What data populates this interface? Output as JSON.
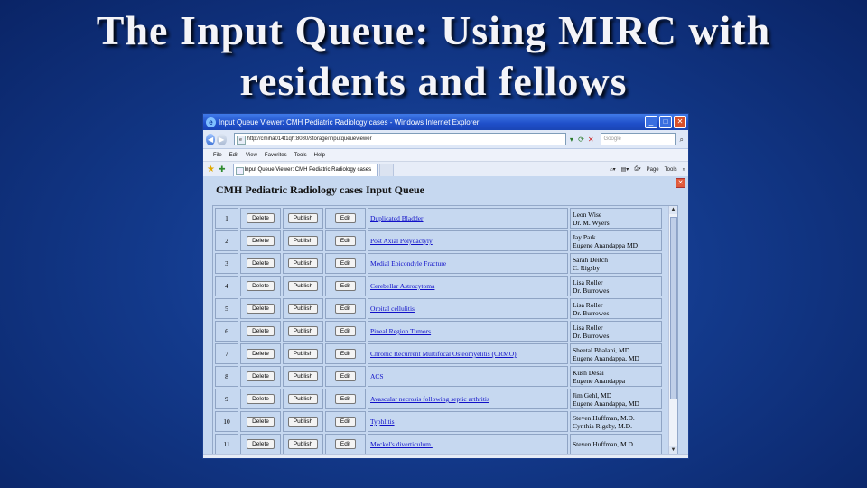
{
  "slide": {
    "title_line1": "The Input Queue:  Using MIRC with",
    "title_line2": "residents and fellows"
  },
  "browser": {
    "window_title": "Input Queue Viewer: CMH Pediatric Radiology cases - Windows Internet Explorer",
    "url": "http://cmiha014t1qh:8080/storage/inputqueueviewer",
    "search_placeholder": "Google",
    "menu": [
      "File",
      "Edit",
      "View",
      "Favorites",
      "Tools",
      "Help"
    ],
    "tab_label": "Input Queue Viewer: CMH Pediatric Radiology cases",
    "commands": {
      "page": "Page",
      "tools": "Tools"
    }
  },
  "page": {
    "heading": "CMH Pediatric Radiology cases Input Queue",
    "button_labels": {
      "delete": "Delete",
      "publish": "Publish",
      "edit": "Edit"
    },
    "rows": [
      {
        "num": "1",
        "title": "Duplicated Bladder",
        "name1": "Leon Wise",
        "name2": "Dr. M. Wyers"
      },
      {
        "num": "2",
        "title": "Post Axial Polydactyly",
        "name1": "Jay Park",
        "name2": "Eugene Anandappa MD"
      },
      {
        "num": "3",
        "title": "Medial Epicondyle Fracture",
        "name1": "Sarah Deitch",
        "name2": "C. Rigsby"
      },
      {
        "num": "4",
        "title": "Cerebellar Astrocytoma",
        "name1": "Lisa Roller",
        "name2": "Dr. Burrowes"
      },
      {
        "num": "5",
        "title": "Orbital cellulitis",
        "name1": "Lisa Roller",
        "name2": "Dr. Burrowes"
      },
      {
        "num": "6",
        "title": "Pineal Region Tumors",
        "name1": "Lisa Roller",
        "name2": "Dr. Burrowes"
      },
      {
        "num": "7",
        "title": "Chronic Recurrent Multifocal Osteomyelitis (CRMO)",
        "name1": "Sheetal Bhalani, MD",
        "name2": "Eugene Anandappa, MD"
      },
      {
        "num": "8",
        "title": "ACS",
        "name1": "Kush Desai",
        "name2": "Eugene Anandappa"
      },
      {
        "num": "9",
        "title": "Avascular necrosis following septic arthritis",
        "name1": "Jim Gehl, MD",
        "name2": "Eugene Anandappa, MD"
      },
      {
        "num": "10",
        "title": "Typhlitis",
        "name1": "Steven Huffman, M.D.",
        "name2": "Cynthia Rigsby, M.D."
      },
      {
        "num": "11",
        "title": "Meckel's diverticulum.",
        "name1": "Steven Huffman, M.D.",
        "name2": ""
      }
    ]
  }
}
